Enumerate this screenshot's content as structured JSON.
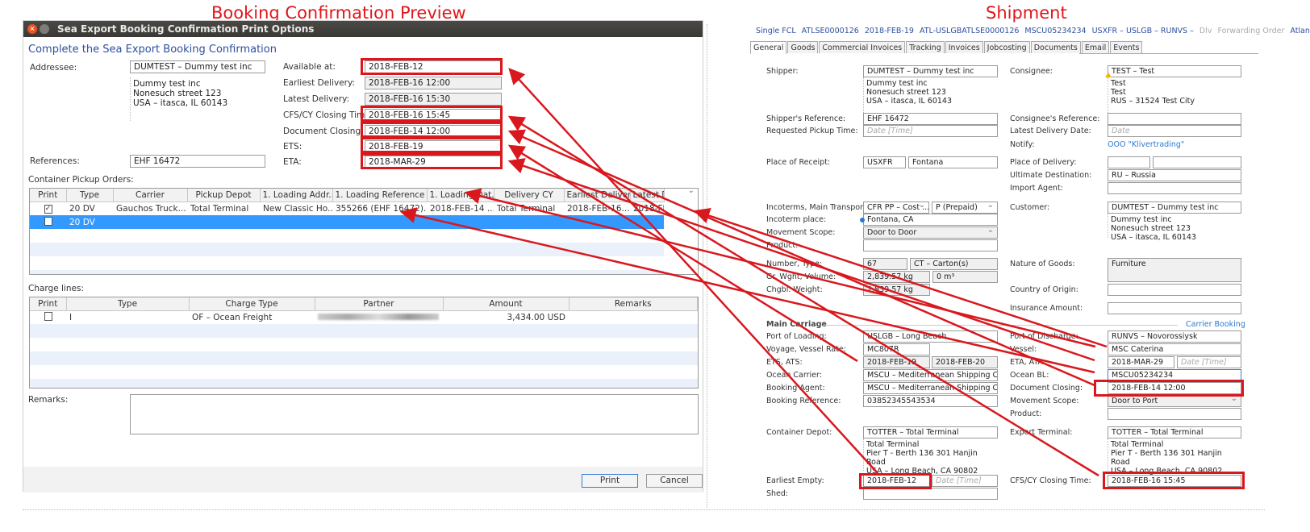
{
  "annotations": {
    "left_title": "Booking Confirmation Preview",
    "right_title": "Shipment"
  },
  "dialog": {
    "title": "Sea Export Booking Confirmation Print Options",
    "subtitle": "Complete the Sea Export Booking Confirmation",
    "addressee_label": "Addressee:",
    "addressee_value": "DUMTEST – Dummy test inc",
    "address_lines": [
      "Dummy test inc",
      "Nonesuch street 123",
      "USA – itasca, IL 60143"
    ],
    "references_label": "References:",
    "references_value": "EHF 16472",
    "dates": [
      {
        "label": "Available at:",
        "value": "2018-FEB-12"
      },
      {
        "label": "Earliest Delivery:",
        "value": "2018-FEB-16 12:00"
      },
      {
        "label": "Latest Delivery:",
        "value": "2018-FEB-16 15:30"
      },
      {
        "label": "CFS/CY Closing Time",
        "value": "2018-FEB-16 15:45"
      },
      {
        "label": "Document Closing:",
        "value": "2018-FEB-14 12:00"
      },
      {
        "label": "ETS:",
        "value": "2018-FEB-19"
      },
      {
        "label": "ETA:",
        "value": "2018-MAR-29"
      }
    ],
    "pickup_label": "Container Pickup Orders:",
    "pickup_columns": [
      "Print",
      "Type",
      "Carrier",
      "Pickup Depot",
      "1. Loading Addr...",
      "1. Loading Reference",
      "1. Loading Dat...",
      "Delivery CY",
      "Earliest Delivery",
      "Latest Delivery"
    ],
    "pickup_rows": [
      {
        "print": true,
        "cells": [
          "20 DV",
          "Gauchos Truck...",
          "Total Terminal",
          "New Classic Ho...",
          "355266 (EHF 16472)...",
          "2018-FEB-14 ...",
          "Total Terminal",
          "2018-FEB-16...",
          "2018-FEB-16..."
        ]
      },
      {
        "print": false,
        "selected": true,
        "cells": [
          "20 DV",
          "",
          "",
          "",
          "",
          "",
          "",
          "",
          ""
        ]
      }
    ],
    "charge_label": "Charge lines:",
    "charge_columns": [
      "Print",
      "Type",
      "Charge Type",
      "Partner",
      "Amount",
      "Remarks"
    ],
    "charge_rows": [
      {
        "print": false,
        "cells": [
          "I",
          "OF – Ocean Freight",
          "",
          "3,434.00 USD",
          ""
        ]
      }
    ],
    "remarks_label": "Remarks:",
    "remarks_value": "",
    "print_button": "Print",
    "cancel_button": "Cancel"
  },
  "shipment": {
    "header": [
      {
        "text": "Single FCL",
        "muted": false
      },
      {
        "text": "ATLSE0000126",
        "muted": false
      },
      {
        "text": "2018-FEB-19",
        "muted": false
      },
      {
        "text": "ATL-USLGBATLSE0000126",
        "muted": false
      },
      {
        "text": "MSCU05234234",
        "muted": false
      },
      {
        "text": "USXFR – USLGB – RUNVS –",
        "muted": false
      },
      {
        "text": "Dlv",
        "muted": true
      },
      {
        "text": "Forwarding Order",
        "muted": true
      },
      {
        "text": "Atlanta",
        "muted": false
      }
    ],
    "tabs": [
      "General",
      "Goods",
      "Commercial Invoices",
      "Tracking",
      "Invoices",
      "Jobcosting",
      "Documents",
      "Email",
      "Events"
    ],
    "active_tab": "General",
    "main_carriage": "Main Carriage",
    "carrier_booking": "Carrier Booking",
    "f": {
      "shipper": {
        "label": "Shipper:",
        "value": "DUMTEST – Dummy test inc",
        "address": [
          "Dummy test inc",
          "Nonesuch street 123",
          "USA – itasca, IL 60143"
        ]
      },
      "shipper_ref": {
        "label": "Shipper's Reference:",
        "value": "EHF 16472"
      },
      "req_pickup": {
        "label": "Requested Pickup Time:",
        "placeholder": "Date [Time]"
      },
      "place_receipt": {
        "label": "Place of Receipt:",
        "code": "USXFR",
        "name": "Fontana"
      },
      "incoterms": {
        "label": "Incoterms, Main Transport:",
        "value": "CFR PP – Cost ...",
        "transport": "P (Prepaid)"
      },
      "incoterm_place": {
        "label": "Incoterm place:",
        "value": "Fontana, CA"
      },
      "movement_scope": {
        "label": "Movement Scope:",
        "value": "Door to Door"
      },
      "product": {
        "label": "Product:",
        "value": ""
      },
      "number_type": {
        "label": "Number, Type:",
        "number": "67",
        "type": "CT – Carton(s)"
      },
      "gr_weight": {
        "label": "Gr. Wght, Volume:",
        "weight": "2,839.57 kg",
        "volume": "0 m³"
      },
      "chg_weight": {
        "label": "Chgbl. Weight:",
        "value": "2,839.57 kg"
      },
      "port_loading": {
        "label": "Port of Loading:",
        "value": "USLGB – Long Beach"
      },
      "voyage": {
        "label": "Voyage, Vessel Rate:",
        "value": "MC807R"
      },
      "ets_ats": {
        "label": "ETS, ATS:",
        "ets": "2018-FEB-19",
        "ats": "2018-FEB-20"
      },
      "ocean_carrier": {
        "label": "Ocean Carrier:",
        "value": "MSCU – Mediterranean Shipping Corp"
      },
      "booking_agent": {
        "label": "Booking Agent:",
        "value": "MSCU – Mediterranean Shipping Co Usa"
      },
      "booking_ref": {
        "label": "Booking Reference:",
        "value": "03852345543534"
      },
      "container_depot": {
        "label": "Container Depot:",
        "value": "TOTTER – Total Terminal",
        "address": [
          "Total Terminal",
          "Pier T - Berth 136 301 Hanjin Road",
          "USA – Long Beach, CA 90802"
        ]
      },
      "earliest_empty": {
        "label": "Earliest Empty:",
        "value": "2018-FEB-12",
        "placeholder": "Date [Time]"
      },
      "shed": {
        "label": "Shed:",
        "value": ""
      },
      "consignee": {
        "label": "Consignee:",
        "value": "TEST – Test",
        "address": [
          "Test",
          "Test",
          "RUS – 31524 Test City"
        ]
      },
      "consignee_ref": {
        "label": "Consignee's Reference:",
        "value": ""
      },
      "latest_delivery": {
        "label": "Latest Delivery Date:",
        "placeholder": "Date"
      },
      "notify": {
        "label": "Notify:",
        "value": "OOO \"Klivertrading\""
      },
      "place_delivery": {
        "label": "Place of Delivery:",
        "value": ""
      },
      "ultimate_dest": {
        "label": "Ultimate Destination:",
        "value": "RU – Russia"
      },
      "import_agent": {
        "label": "Import Agent:",
        "value": ""
      },
      "customer": {
        "label": "Customer:",
        "value": "DUMTEST – Dummy test inc",
        "address": [
          "Dummy test inc",
          "Nonesuch street 123",
          "USA – itasca, IL 60143"
        ]
      },
      "nature_goods": {
        "label": "Nature of Goods:",
        "value": "Furniture"
      },
      "country_origin": {
        "label": "Country of Origin:",
        "value": ""
      },
      "insurance": {
        "label": "Insurance Amount:",
        "value": ""
      },
      "port_discharge": {
        "label": "Port of Discharge:",
        "value": "RUNVS – Novorossiysk"
      },
      "vessel": {
        "label": "Vessel:",
        "value": "MSC Caterina"
      },
      "eta_ata": {
        "label": "ETA, ATA:",
        "eta": "2018-MAR-29",
        "placeholder": "Date [Time]"
      },
      "ocean_bl": {
        "label": "Ocean BL:",
        "value": "MSCU05234234"
      },
      "doc_closing": {
        "label": "Document Closing:",
        "value": "2018-FEB-14 12:00"
      },
      "movement_scope2": {
        "label": "Movement Scope:",
        "value": "Door to Port"
      },
      "product2": {
        "label": "Product:",
        "value": ""
      },
      "export_terminal": {
        "label": "Export Terminal:",
        "value": "TOTTER – Total Terminal",
        "address": [
          "Total Terminal",
          "Pier T - Berth 136 301 Hanjin Road",
          "USA – Long Beach, CA 90802"
        ]
      },
      "cfs_closing": {
        "label": "CFS/CY Closing Time:",
        "value": "2018-FEB-16 15:45"
      }
    }
  }
}
